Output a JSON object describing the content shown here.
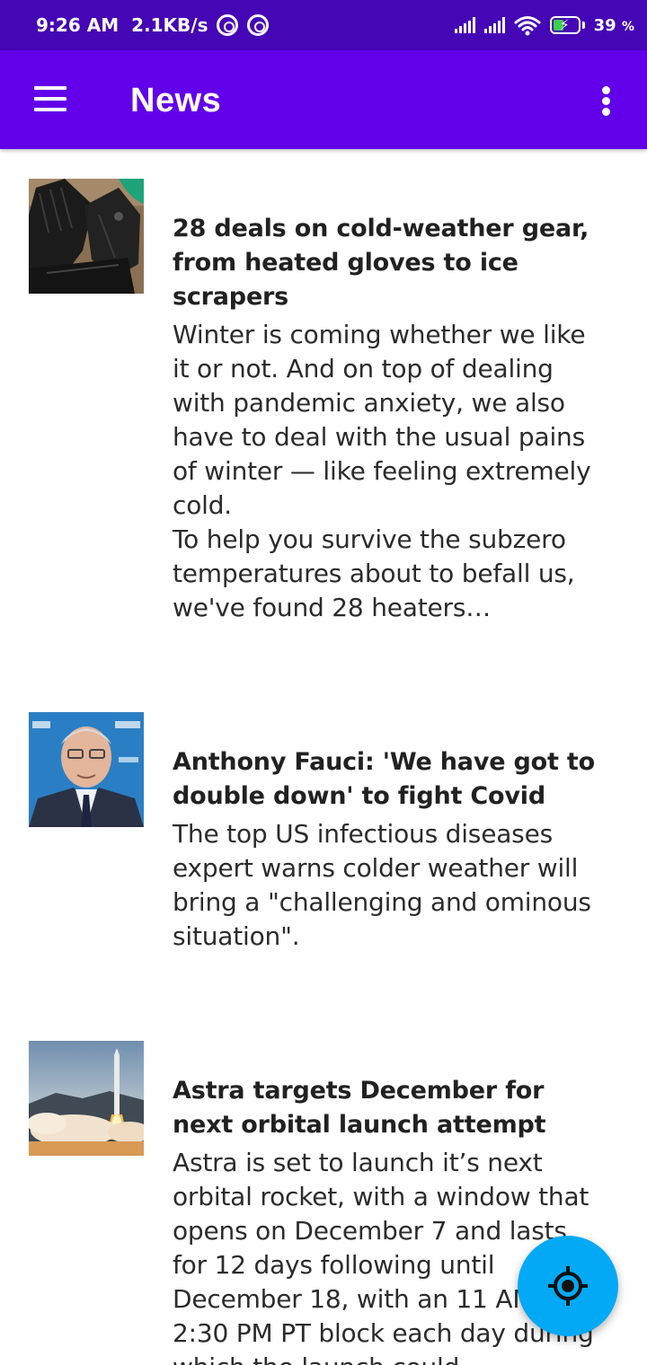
{
  "status_bar": {
    "time": "9:26 AM",
    "speed": "2.1KB/s",
    "battery_pct": "39",
    "battery_unit": "%"
  },
  "app_bar": {
    "title": "News",
    "menu_icon": "hamburger-menu-icon",
    "overflow_icon": "more-vert-icon"
  },
  "articles": [
    {
      "image": "leather-gloves-photo",
      "headline": "28 deals on cold-weather gear, from heated gloves to ice scrapers",
      "description": "Winter is coming whether we like it or not. And on top of dealing with pandemic anxiety, we also have to deal with the usual pains of winter — like feeling extremely cold.\nTo help you survive the subzero temperatures about to befall us, we've found 28 heaters…"
    },
    {
      "image": "anthony-fauci-photo",
      "headline": "Anthony Fauci: 'We have got to double down' to fight Covid",
      "description": "The top US infectious diseases expert warns colder weather will bring a \"challenging and ominous situation\"."
    },
    {
      "image": "rocket-launch-photo",
      "headline": "Astra targets December for next orbital launch attempt",
      "description": "Astra is set to launch it’s next orbital rocket, with a window that opens on December 7 and lasts for 12 days following until December 18, with an 11 AM to 2:30 PM PT block each day during which the launch could"
    }
  ],
  "fab": {
    "icon": "my-location-icon"
  },
  "colors": {
    "status_bar": "#4506b5",
    "app_bar": "#6200ea",
    "fab": "#03a9f4"
  }
}
